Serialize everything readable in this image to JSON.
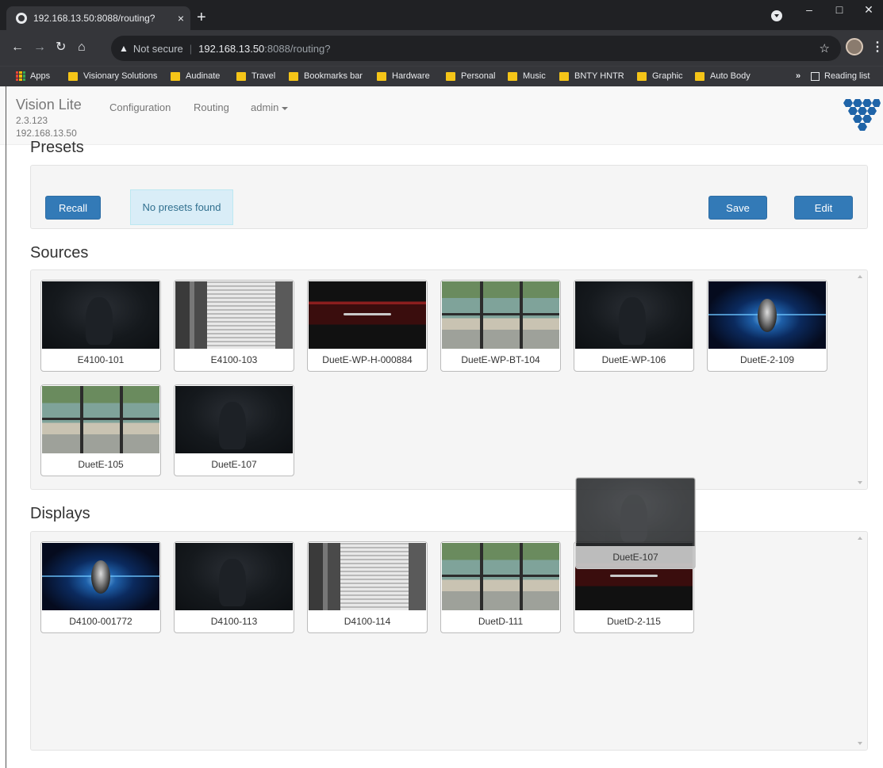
{
  "browser": {
    "tab_title": "192.168.13.50:8088/routing?",
    "tab_close": "×",
    "new_tab": "+",
    "security_label": "Not secure",
    "url_host": "192.168.13.50",
    "url_path": ":8088/routing?",
    "bookmarks": [
      "Apps",
      "Visionary Solutions",
      "Audinate",
      "Travel",
      "Bookmarks bar",
      "Hardware",
      "Personal",
      "Music",
      "BNTY HNTR",
      "Graphic",
      "Auto Body"
    ],
    "more_bookmarks": "»",
    "reading_list": "Reading list"
  },
  "app": {
    "name": "Vision Lite",
    "version": "2.3.123",
    "ip": "192.168.13.50",
    "nav": {
      "configuration": "Configuration",
      "routing": "Routing",
      "admin": "admin"
    }
  },
  "presets": {
    "title": "Presets",
    "recall_label": "Recall",
    "empty_message": "No presets found",
    "save_label": "Save",
    "edit_label": "Edit"
  },
  "sources": {
    "title": "Sources",
    "items": [
      {
        "name": "E4100-101",
        "thumb": "dark"
      },
      {
        "name": "E4100-103",
        "thumb": "blind"
      },
      {
        "name": "DuetE-WP-H-000884",
        "thumb": "red"
      },
      {
        "name": "DuetE-WP-BT-104",
        "thumb": "plant"
      },
      {
        "name": "DuetE-WP-106",
        "thumb": "dark"
      },
      {
        "name": "DuetE-2-109",
        "thumb": "space"
      },
      {
        "name": "DuetE-105",
        "thumb": "plant"
      },
      {
        "name": "DuetE-107",
        "thumb": "dark"
      }
    ]
  },
  "displays": {
    "title": "Displays",
    "items": [
      {
        "name": "D4100-001772",
        "thumb": "space"
      },
      {
        "name": "D4100-113",
        "thumb": "dark"
      },
      {
        "name": "D4100-114",
        "thumb": "blind"
      },
      {
        "name": "DuetD-111",
        "thumb": "plant"
      },
      {
        "name": "DuetD-2-115",
        "thumb": "red"
      }
    ]
  },
  "dragging": {
    "name": "DuetE-107"
  }
}
